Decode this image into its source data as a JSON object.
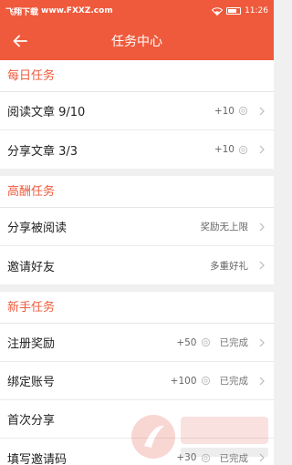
{
  "status_bar": {
    "watermark_name": "飞翔下载",
    "watermark_url": "www.FXXZ.com",
    "time": "11:26"
  },
  "header": {
    "title": "任务中心"
  },
  "sections": {
    "daily": {
      "title": "每日任务",
      "items": [
        {
          "label": "阅读文章  9/10",
          "reward": "+10"
        },
        {
          "label": "分享文章  3/3",
          "reward": "+10"
        }
      ]
    },
    "high": {
      "title": "高酬任务",
      "items": [
        {
          "label": "分享被阅读",
          "reward": "奖励无上限"
        },
        {
          "label": "邀请好友",
          "reward": "多重好礼"
        }
      ]
    },
    "newbie": {
      "title": "新手任务",
      "items": [
        {
          "label": "注册奖励",
          "reward": "+50",
          "status": "已完成"
        },
        {
          "label": "绑定账号",
          "reward": "+100",
          "status": "已完成"
        },
        {
          "label": "首次分享",
          "reward": "",
          "status": ""
        },
        {
          "label": "填写邀请码",
          "reward": "+30",
          "status": "已完成"
        }
      ]
    }
  },
  "colors": {
    "accent": "#ef5a3c",
    "background": "#f0f0f0"
  }
}
